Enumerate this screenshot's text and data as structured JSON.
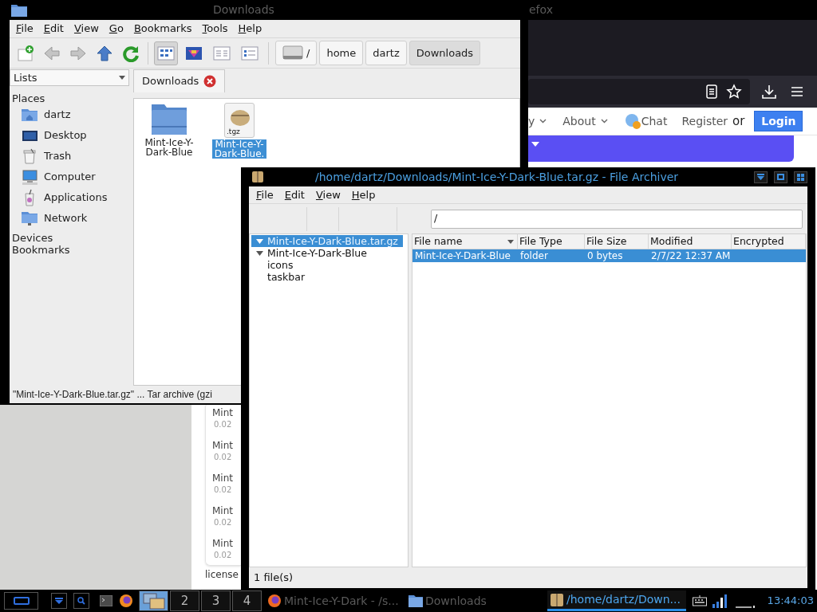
{
  "firefox": {
    "title": "efox",
    "nav_links": [
      {
        "label": "y",
        "kind": "dropdown"
      },
      {
        "label": "About",
        "kind": "dropdown"
      },
      {
        "label": "Chat",
        "kind": "chat"
      },
      {
        "label": "Register",
        "kind": "link"
      }
    ],
    "or_text": "or",
    "login_button": "Login",
    "downloads": [
      {
        "name": "Mint",
        "size": "0.02"
      },
      {
        "name": "Mint",
        "size": "0.02"
      },
      {
        "name": "Mint",
        "size": "0.02"
      },
      {
        "name": "Mint",
        "size": "0.02"
      },
      {
        "name": "Mint",
        "size": "0.02"
      }
    ],
    "footer_text": "license"
  },
  "file_manager": {
    "title": "Downloads",
    "menu": [
      "File",
      "Edit",
      "View",
      "Go",
      "Bookmarks",
      "Tools",
      "Help"
    ],
    "view_modes": [
      {
        "kind": "icons",
        "selected": true
      },
      {
        "kind": "thumbnails",
        "selected": false
      },
      {
        "kind": "compact",
        "selected": false
      },
      {
        "kind": "list",
        "selected": false
      }
    ],
    "path": [
      {
        "label": "/",
        "kind": "drive",
        "selected": false
      },
      {
        "label": "home",
        "kind": "folder",
        "selected": false
      },
      {
        "label": "dartz",
        "kind": "folder",
        "selected": false
      },
      {
        "label": "Downloads",
        "kind": "folder",
        "selected": true
      }
    ],
    "side_pane_mode": "Lists",
    "sidebar": [
      {
        "heading": "Places",
        "items": [
          {
            "label": "dartz",
            "kind": "home"
          },
          {
            "label": "Desktop",
            "kind": "desktop"
          },
          {
            "label": "Trash",
            "kind": "trash"
          },
          {
            "label": "Computer",
            "kind": "computer"
          },
          {
            "label": "Applications",
            "kind": "applications"
          },
          {
            "label": "Network",
            "kind": "network"
          }
        ]
      },
      {
        "heading": "Devices"
      },
      {
        "heading": "Bookmarks"
      }
    ],
    "tabs": [
      {
        "label": "Downloads",
        "selected": true
      }
    ],
    "files": [
      {
        "name": "Mint-Ice-Y-Dark-Blue",
        "kind": "folder",
        "selected": false
      },
      {
        "name": "Mint-Ice-Y-Dark-Blue.",
        "kind": "archive",
        "badge": ".tgz",
        "selected": true
      }
    ],
    "status": "\"Mint-Ice-Y-Dark-Blue.tar.gz\" ... Tar archive (gzi"
  },
  "archiver": {
    "title": "/home/dartz/Downloads/Mint-Ice-Y-Dark-Blue.tar.gz - File Archiver",
    "menu": [
      "File",
      "Edit",
      "View",
      "Help"
    ],
    "location": "/",
    "tree": [
      {
        "label": "Mint-Ice-Y-Dark-Blue.tar.gz",
        "selected": true,
        "expanded": true,
        "children": [
          {
            "label": "Mint-Ice-Y-Dark-Blue",
            "selected": false,
            "expanded": true,
            "children": [
              {
                "label": "icons",
                "selected": false
              },
              {
                "label": "taskbar",
                "selected": false
              }
            ]
          }
        ]
      }
    ],
    "columns": [
      {
        "label": "File name",
        "sorted": true
      },
      {
        "label": "File Type",
        "sorted": false
      },
      {
        "label": "File Size",
        "sorted": false
      },
      {
        "label": "Modified",
        "sorted": false
      },
      {
        "label": "Encrypted",
        "sorted": false
      }
    ],
    "rows": [
      {
        "cells": [
          "Mint-Ice-Y-Dark-Blue",
          "folder",
          "0 bytes",
          "2/7/22 12:37 AM"
        ],
        "selected": true
      }
    ],
    "status": "1 file(s)"
  },
  "taskbar": {
    "launchers": [
      {
        "kind": "menu"
      },
      {
        "kind": "window-list"
      },
      {
        "kind": "search"
      },
      {
        "kind": "terminal"
      },
      {
        "kind": "browser"
      }
    ],
    "desktops": [
      {
        "kind": "preview",
        "selected": true
      },
      {
        "label": "2",
        "selected": false
      },
      {
        "label": "3",
        "selected": false
      },
      {
        "label": "4",
        "selected": false
      }
    ],
    "tasks": [
      {
        "title": "Mint-Ice-Y-Dark - /s...",
        "kind": "browser",
        "selected": false
      },
      {
        "title": "Downloads",
        "kind": "folder",
        "selected": false
      },
      {
        "title": "/home/dartz/Down...",
        "kind": "archive",
        "selected": true
      }
    ],
    "clock": "13:44:03"
  }
}
